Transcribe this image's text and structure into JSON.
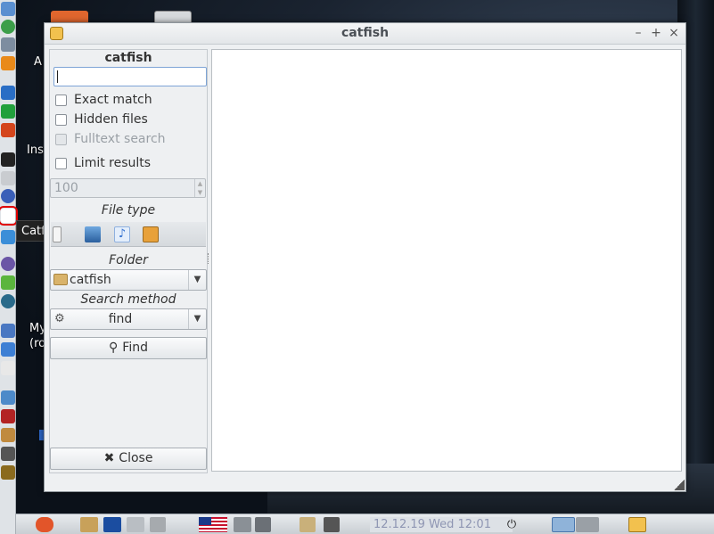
{
  "desktop": {
    "labels": [
      "A",
      "Ins",
      "My",
      "(ro"
    ]
  },
  "launcher": {
    "tooltip": "Catfish"
  },
  "window": {
    "title": "catfish",
    "controls": {
      "minimize": "–",
      "maximize": "+",
      "close": "×"
    }
  },
  "sidebar": {
    "title": "catfish",
    "search": {
      "value": "",
      "placeholder": ""
    },
    "options": {
      "exact_match": "Exact match",
      "hidden_files": "Hidden files",
      "fulltext_search": "Fulltext search",
      "limit_results": "Limit results"
    },
    "limit_value": "100",
    "file_type_label": "File type",
    "folder_label": "Folder",
    "folder_value": "catfish",
    "search_method_label": "Search method",
    "search_method_value": "find",
    "find_button": "Find",
    "close_button": "Close"
  },
  "taskbar": {
    "clock": "12.12.19 Wed 12:01"
  },
  "colors": {
    "accent_highlight": "#e00000",
    "window_bg": "#eef0f2",
    "results_bg": "#ffffff"
  }
}
